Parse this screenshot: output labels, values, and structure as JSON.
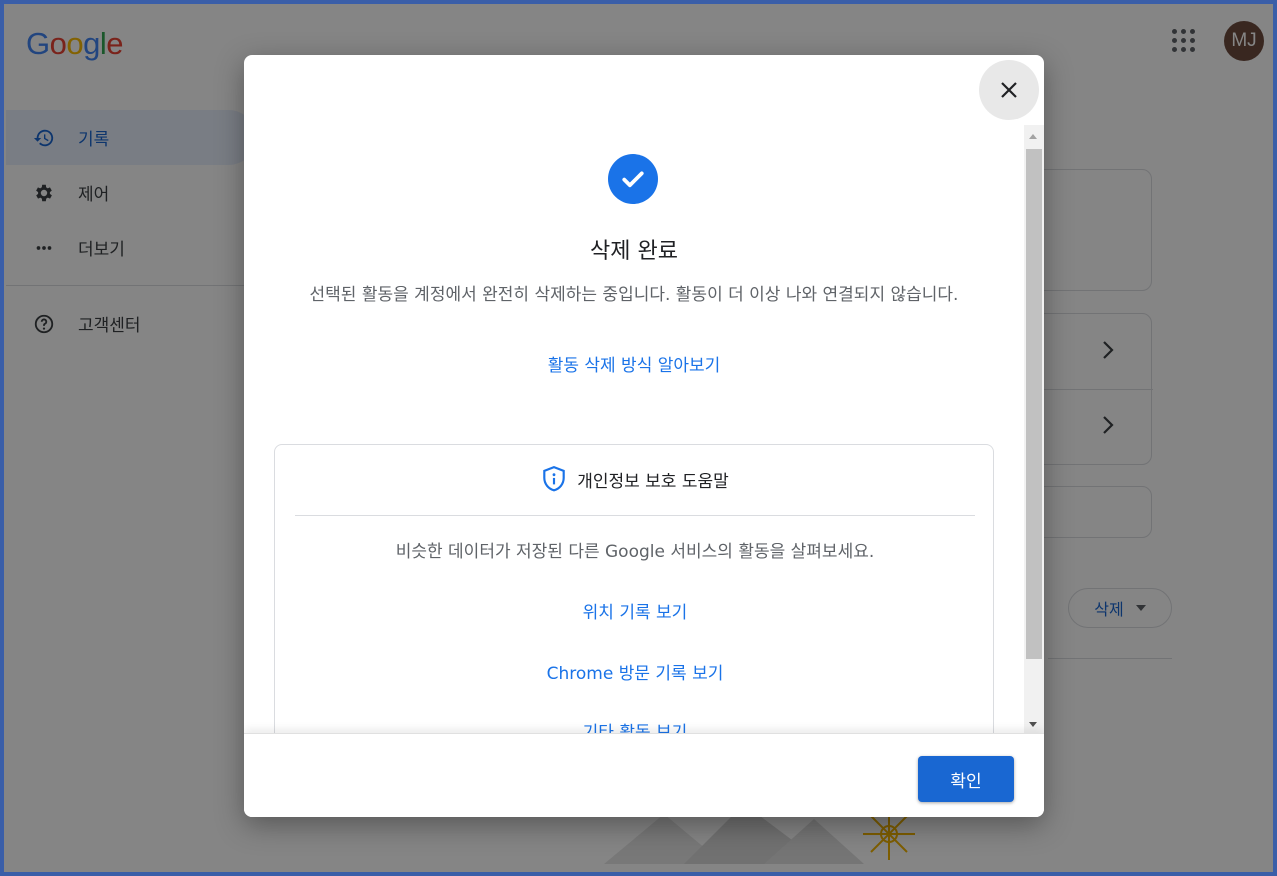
{
  "header": {
    "logo_letters": [
      "G",
      "o",
      "o",
      "g",
      "l",
      "e"
    ],
    "logo_colors": [
      "#4285F4",
      "#EA4335",
      "#FBBC05",
      "#4285F4",
      "#34A853",
      "#EA4335"
    ],
    "avatar_initials": "MJ"
  },
  "sidebar": {
    "items": [
      {
        "label": "기록",
        "icon": "history-icon",
        "active": true
      },
      {
        "label": "제어",
        "icon": "gear-icon",
        "active": false
      },
      {
        "label": "더보기",
        "icon": "more-horiz-icon",
        "active": false
      },
      {
        "label": "고객센터",
        "icon": "help-icon",
        "active": false
      }
    ]
  },
  "background": {
    "delete_menu_label": "삭제"
  },
  "dialog": {
    "title": "삭제 완료",
    "description": "선택된 활동을 계정에서 완전히 삭제하는 중입니다. 활동이 더 이상 나와 연결되지 않습니다.",
    "learn_link": "활동 삭제 방식 알아보기",
    "privacy_card": {
      "heading": "개인정보 보호 도움말",
      "text": "비슷한 데이터가 저장된 다른 Google 서비스의 활동을 살펴보세요.",
      "links": [
        "위치 기록 보기",
        "Chrome 방문 기록 보기",
        "기타 활동 보기"
      ]
    },
    "confirm_button": "확인"
  },
  "colors": {
    "accent": "#1a73e8",
    "button_blue": "#1967d2"
  }
}
